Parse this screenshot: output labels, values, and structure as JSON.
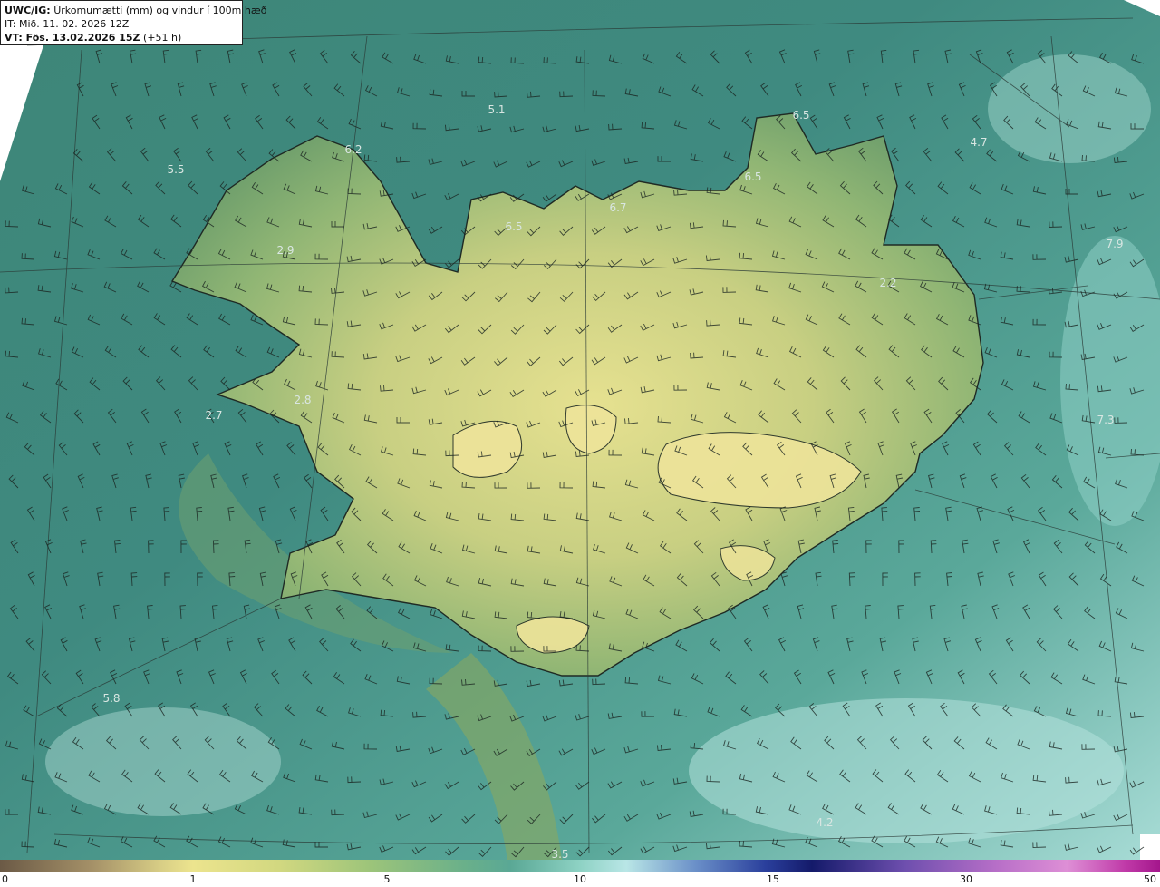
{
  "header": {
    "model": "UWC/IG:",
    "title": "Úrkomumætti (mm) og vindur í 100m hæð",
    "it_label": "IT:",
    "it_value": "Mið. 11. 02. 2026 12Z",
    "vt_label": "VT: Fös. 13.02.2026 15Z",
    "vt_offset": "(+51 h)"
  },
  "colorbar": {
    "ticks": [
      {
        "value": 0,
        "label": "0"
      },
      {
        "value": 1,
        "label": "1"
      },
      {
        "value": 5,
        "label": "5"
      },
      {
        "value": 10,
        "label": "10"
      },
      {
        "value": 15,
        "label": "15"
      },
      {
        "value": 30,
        "label": "30"
      },
      {
        "value": 50,
        "label": "50"
      }
    ]
  },
  "map_labels": [
    "5.1",
    "6.5",
    "4.7",
    "6.2",
    "5.5",
    "6.5",
    "6.5",
    "6.7",
    "2.9",
    "7.9",
    "2.2",
    "2.7",
    "2.8",
    "7.3",
    "5.8",
    "4.2",
    "3.5"
  ],
  "colors": {
    "sea": "#3f8a80",
    "land_high": "#e3df8e",
    "land_low": "#7aa66e",
    "coast": "#1f2a24"
  }
}
